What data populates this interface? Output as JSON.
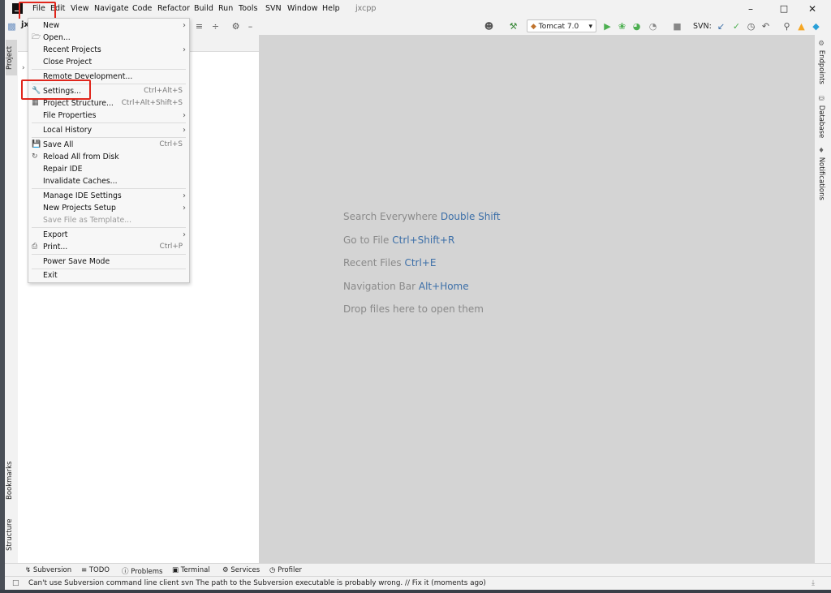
{
  "menubar": {
    "items": [
      "File",
      "Edit",
      "View",
      "Navigate",
      "Code",
      "Refactor",
      "Build",
      "Run",
      "Tools",
      "SVN",
      "Window",
      "Help"
    ],
    "project_name": "jxcpp"
  },
  "toolbar": {
    "project_label": "jx",
    "run_config": "Tomcat 7.0",
    "svn_label": "SVN:"
  },
  "left_stripe": {
    "project": "Project",
    "bookmarks": "Bookmarks",
    "structure": "Structure"
  },
  "right_stripe": {
    "endpoints": "Endpoints",
    "database": "Database",
    "notifications": "Notifications"
  },
  "file_menu": {
    "items": [
      {
        "label": "New"
      },
      {
        "label": "Open..."
      },
      {
        "label": "Recent Projects"
      },
      {
        "label": "Close Project"
      },
      {
        "label": "Remote Development..."
      },
      {
        "label": "Settings...",
        "shortcut": "Ctrl+Alt+S"
      },
      {
        "label": "Project Structure...",
        "shortcut": "Ctrl+Alt+Shift+S"
      },
      {
        "label": "File Properties"
      },
      {
        "label": "Local History"
      },
      {
        "label": "Save All",
        "shortcut": "Ctrl+S"
      },
      {
        "label": "Reload All from Disk"
      },
      {
        "label": "Repair IDE"
      },
      {
        "label": "Invalidate Caches..."
      },
      {
        "label": "Manage IDE Settings"
      },
      {
        "label": "New Projects Setup"
      },
      {
        "label": "Save File as Template..."
      },
      {
        "label": "Export"
      },
      {
        "label": "Print...",
        "shortcut": "Ctrl+P"
      },
      {
        "label": "Power Save Mode"
      },
      {
        "label": "Exit"
      }
    ]
  },
  "editor_hints": [
    {
      "text": "Search Everywhere",
      "key": "Double Shift"
    },
    {
      "text": "Go to File",
      "key": "Ctrl+Shift+R"
    },
    {
      "text": "Recent Files",
      "key": "Ctrl+E"
    },
    {
      "text": "Navigation Bar",
      "key": "Alt+Home"
    },
    {
      "text": "Drop files here to open them",
      "key": ""
    }
  ],
  "bottom_tabs": [
    "Subversion",
    "TODO",
    "Problems",
    "Terminal",
    "Services",
    "Profiler"
  ],
  "status": {
    "message": "Can't use Subversion command line client svn The path to the Subversion executable is probably wrong. // Fix it (moments ago)"
  },
  "colors": {
    "highlight": "#e0261c",
    "accent_blue": "#3c6fa8",
    "run_green": "#4caf50"
  }
}
